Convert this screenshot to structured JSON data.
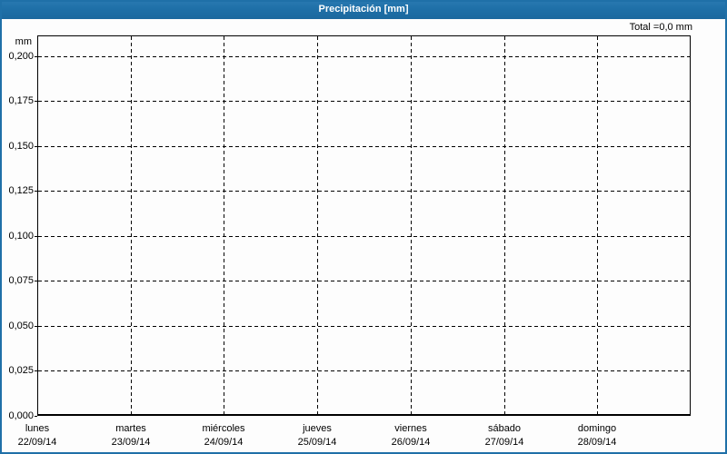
{
  "header": {
    "title": "Precipitación [mm]",
    "total_label": "Total =0,0 mm"
  },
  "chart_data": {
    "type": "bar",
    "title": "Precipitación [mm]",
    "xlabel": "",
    "ylabel": "mm",
    "total": "0,0 mm",
    "categories": [
      {
        "day": "lunes",
        "date": "22/09/14"
      },
      {
        "day": "martes",
        "date": "23/09/14"
      },
      {
        "day": "miércoles",
        "date": "24/09/14"
      },
      {
        "day": "jueves",
        "date": "25/09/14"
      },
      {
        "day": "viernes",
        "date": "26/09/14"
      },
      {
        "day": "sábado",
        "date": "27/09/14"
      },
      {
        "day": "domingo",
        "date": "28/09/14"
      }
    ],
    "series": [
      {
        "name": "Precipitación",
        "values": [
          0.0,
          0.0,
          0.0,
          0.0,
          0.0,
          0.0,
          0.0
        ]
      }
    ],
    "ylim": [
      0,
      0.2116
    ],
    "y_ticks": {
      "values": [
        0,
        0.025,
        0.05,
        0.075,
        0.1,
        0.125,
        0.15,
        0.175,
        0.2
      ],
      "labels": [
        "0,000",
        "0,025",
        "0,050",
        "0,075",
        "0,100",
        "0,125",
        "0,150",
        "0,175",
        "0,200"
      ]
    },
    "grid": "dashed",
    "legend": "none"
  },
  "colors": {
    "accent": "#1f70a8",
    "title_text": "#ffffff",
    "background": "#fdfdfd",
    "grid": "#000000",
    "text": "#000000"
  }
}
